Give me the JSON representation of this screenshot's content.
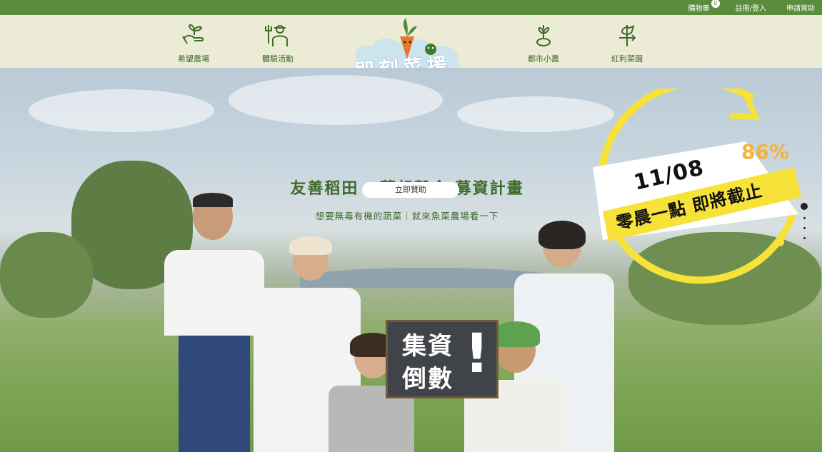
{
  "topbar": {
    "cart_label": "購物車",
    "cart_count": "0",
    "login_label": "註冊/登入",
    "apply_label": "申請資助"
  },
  "nav": {
    "items": [
      {
        "label": "希望農場",
        "icon": "hand-sprout-icon"
      },
      {
        "label": "體驗活動",
        "icon": "farmer-icon"
      },
      {
        "label": "都市小農",
        "icon": "seedling-icon"
      },
      {
        "label": "紅利菜園",
        "icon": "weathervane-icon"
      }
    ],
    "logo_text": "即刻菜援",
    "logo_icon": "carrot-mascot-icon"
  },
  "hero": {
    "title": "友善稻田 · 夢想穀倉 募資計畫",
    "subtitle": "想要無毒有機的蔬菜｜就來魚菜農場看一下",
    "cta_label": "立即贊助",
    "board_line1": "集資",
    "board_line2": "倒數",
    "board_mark": "!"
  },
  "promo": {
    "date": "11/08",
    "percent": "86%",
    "deadline_text": "零晨一點 即將截止",
    "accent_color": "#f7e23a",
    "percent_color": "#f2b33a"
  },
  "colors": {
    "brand_green": "#5a8c3c",
    "nav_bg": "#ecebd6"
  }
}
